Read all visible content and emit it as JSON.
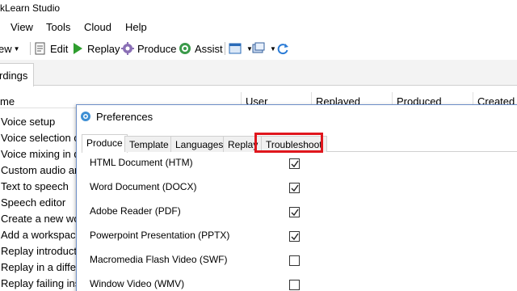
{
  "app": {
    "title": "ckLearn Studio"
  },
  "menu": [
    "View",
    "Tools",
    "Cloud",
    "Help"
  ],
  "toolbar": {
    "new_label": "ew",
    "edit_label": "Edit",
    "replay_label": "Replay",
    "produce_label": "Produce",
    "assist_label": "Assist"
  },
  "main_tab": {
    "label": "rdings"
  },
  "list": {
    "columns": [
      "me",
      "User",
      "Replayed",
      "Produced",
      "Created"
    ],
    "rows": [
      "Voice setup",
      "Voice selection or",
      "Voice mixing in di",
      "Custom audio an",
      "Text to speech",
      "Speech editor",
      "Create a new wor",
      "Add a workspace",
      "Replay introducti",
      "Replay in a differe",
      "Replay failing inst"
    ]
  },
  "dialog": {
    "title": "Preferences",
    "tabs": [
      "Produce",
      "Template",
      "Languages",
      "Replay",
      "Troubleshoot"
    ],
    "active_tab": "Produce",
    "highlighted_tab": "Troubleshoot",
    "options": [
      {
        "label": "HTML Document (HTM)",
        "checked": true
      },
      {
        "label": "Word Document (DOCX)",
        "checked": true
      },
      {
        "label": "Adobe Reader (PDF)",
        "checked": true
      },
      {
        "label": "Powerpoint Presentation (PPTX)",
        "checked": true
      },
      {
        "label": "Macromedia Flash Video (SWF)",
        "checked": false
      },
      {
        "label": "Window Video (WMV)",
        "checked": false
      }
    ]
  },
  "colors": {
    "highlight": "#e0161d",
    "accent": "#6d8fc7"
  }
}
